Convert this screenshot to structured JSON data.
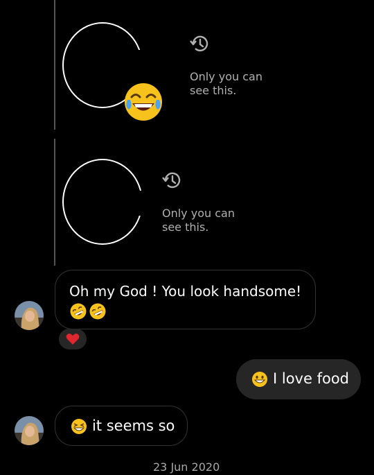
{
  "thread": {
    "story_reply_1": {
      "expired_text": "Only you can see this.",
      "icon": "history-icon",
      "reaction_emoji": "tears-of-joy"
    },
    "story_reply_2": {
      "expired_text": "Only you can see this.",
      "icon": "history-icon"
    },
    "messages": [
      {
        "sender": "them",
        "text": "Oh my God ! You look handsome!",
        "emoji": "rolling-on-floor-laughing x2",
        "reaction": "red-heart"
      },
      {
        "sender": "me",
        "text": "I love food",
        "emoji": "grinning-face"
      },
      {
        "sender": "them",
        "text": "it seems so",
        "emoji": "grinning-squinting-face"
      }
    ],
    "date_separator": "23 Jun 2020"
  },
  "colors": {
    "background": "#000000",
    "sent_bubble": "#262626",
    "received_border": "#333333",
    "muted_text": "#b0b0b0",
    "heart": "#e0262e"
  }
}
